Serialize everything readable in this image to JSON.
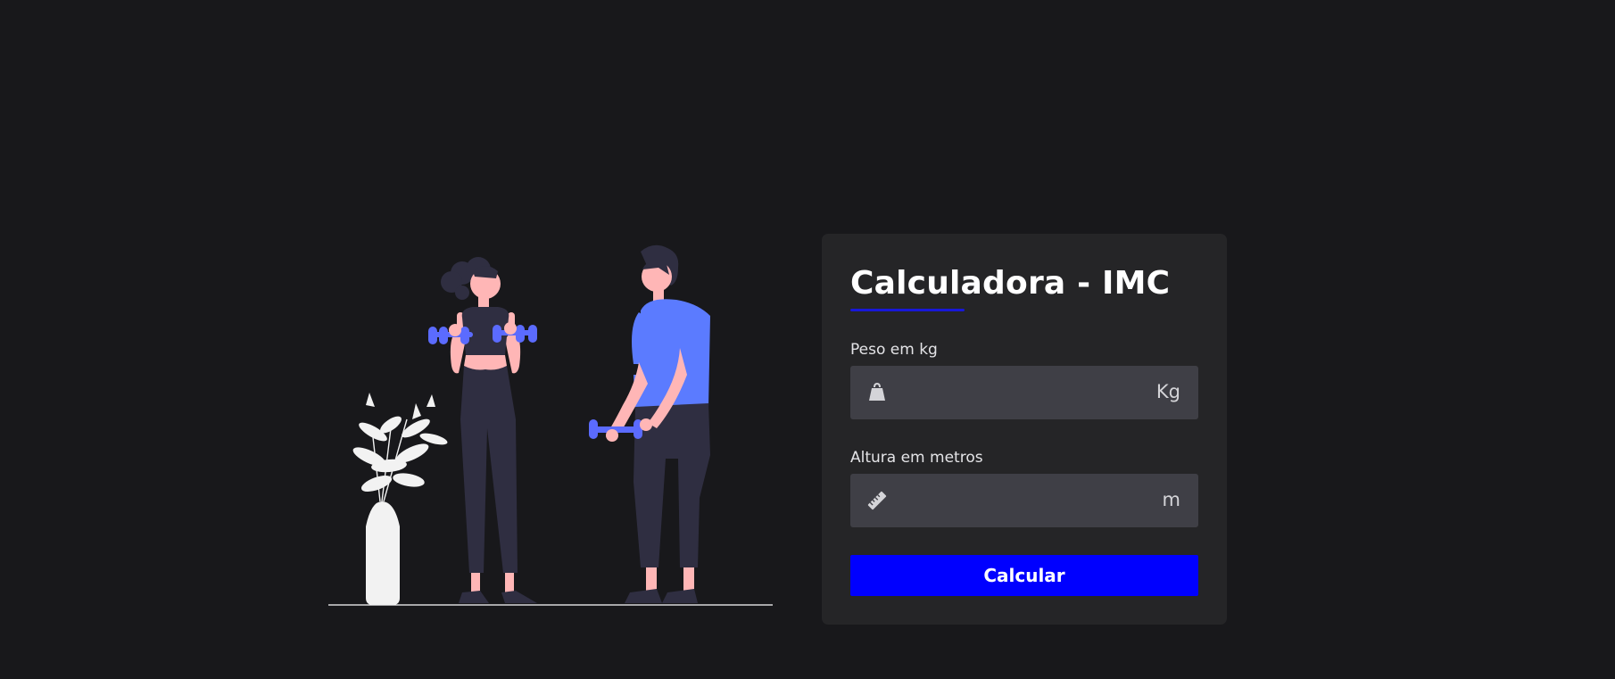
{
  "card": {
    "title": "Calculadora - IMC",
    "accent_color": "#0000ff"
  },
  "weight": {
    "label": "Peso em kg",
    "value": "",
    "unit": "Kg",
    "icon": "weight-icon"
  },
  "height": {
    "label": "Altura em metros",
    "value": "",
    "unit": "m",
    "icon": "ruler-icon"
  },
  "actions": {
    "calculate_label": "Calcular"
  },
  "illustration": {
    "description_icon": "workout-illustration"
  }
}
